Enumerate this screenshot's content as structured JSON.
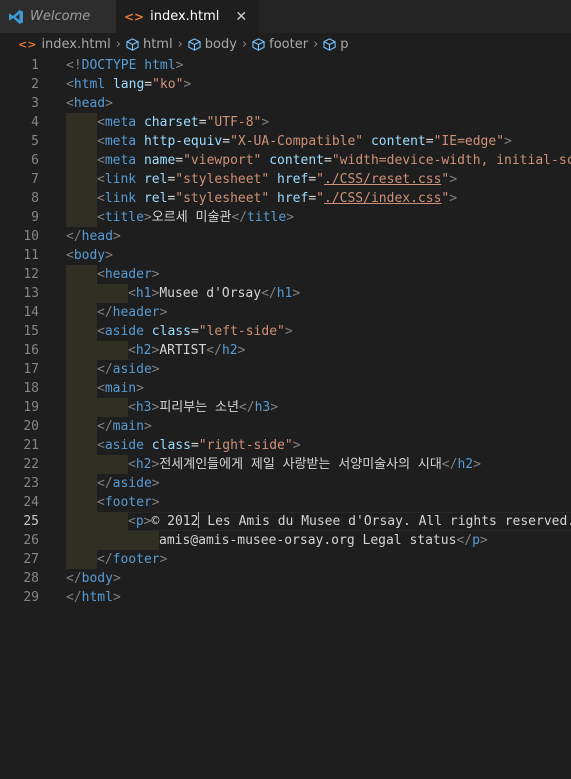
{
  "tabs": [
    {
      "label": "Welcome",
      "icon": "vscode-icon",
      "active": false
    },
    {
      "label": "index.html",
      "icon": "html-file-icon",
      "active": true
    }
  ],
  "breadcrumb": [
    "index.html",
    "html",
    "body",
    "footer",
    "p"
  ],
  "editor": {
    "current_line": 25,
    "lines": [
      {
        "n": "1",
        "text": "<!DOCTYPE html>"
      },
      {
        "n": "2",
        "text": "<html lang=\"ko\">"
      },
      {
        "n": "3",
        "text": "<head>"
      },
      {
        "n": "4",
        "text": "<meta charset=\"UTF-8\">"
      },
      {
        "n": "5",
        "text": "<meta http-equiv=\"X-UA-Compatible\" content=\"IE=edge\">"
      },
      {
        "n": "6",
        "text": "<meta name=\"viewport\" content=\"width=device-width, initial-sca"
      },
      {
        "n": "7",
        "text": "<link rel=\"stylesheet\" href=\"./CSS/reset.css\">"
      },
      {
        "n": "8",
        "text": "<link rel=\"stylesheet\" href=\"./CSS/index.css\">"
      },
      {
        "n": "9",
        "text": "<title>오르세 미술관</title>"
      },
      {
        "n": "10",
        "text": "</head>"
      },
      {
        "n": "11",
        "text": "<body>"
      },
      {
        "n": "12",
        "text": "<header>"
      },
      {
        "n": "13",
        "text": "<h1>Musee d'Orsay</h1>"
      },
      {
        "n": "14",
        "text": "</header>"
      },
      {
        "n": "15",
        "text": "<aside class=\"left-side\">"
      },
      {
        "n": "16",
        "text": "<h2>ARTIST</h2>"
      },
      {
        "n": "17",
        "text": "</aside>"
      },
      {
        "n": "18",
        "text": "<main>"
      },
      {
        "n": "19",
        "text": "<h3>피리부는 소년</h3>"
      },
      {
        "n": "20",
        "text": "</main>"
      },
      {
        "n": "21",
        "text": "<aside class=\"right-side\">"
      },
      {
        "n": "22",
        "text": "<h2>전세계인들에게 제일 사랑받는 서양미술사의 시대</h2>"
      },
      {
        "n": "23",
        "text": "</aside>"
      },
      {
        "n": "24",
        "text": "<footer>"
      },
      {
        "n": "25",
        "text": "<p>© 2012 Les Amis du Musee d'Orsay. All rights reserved."
      },
      {
        "n": "26",
        "text": "amis@amis-musee-orsay.org Legal status</p>"
      },
      {
        "n": "27",
        "text": "</footer>"
      },
      {
        "n": "28",
        "text": "</body>"
      },
      {
        "n": "29",
        "text": "</html>"
      }
    ]
  },
  "colors": {
    "background": "#1e1e1e",
    "tag": "#569cd6",
    "attribute": "#9cdcfe",
    "string": "#ce9178",
    "bracket": "#808080",
    "html_icon": "#e37933",
    "vscode_icon": "#3c99d4"
  }
}
